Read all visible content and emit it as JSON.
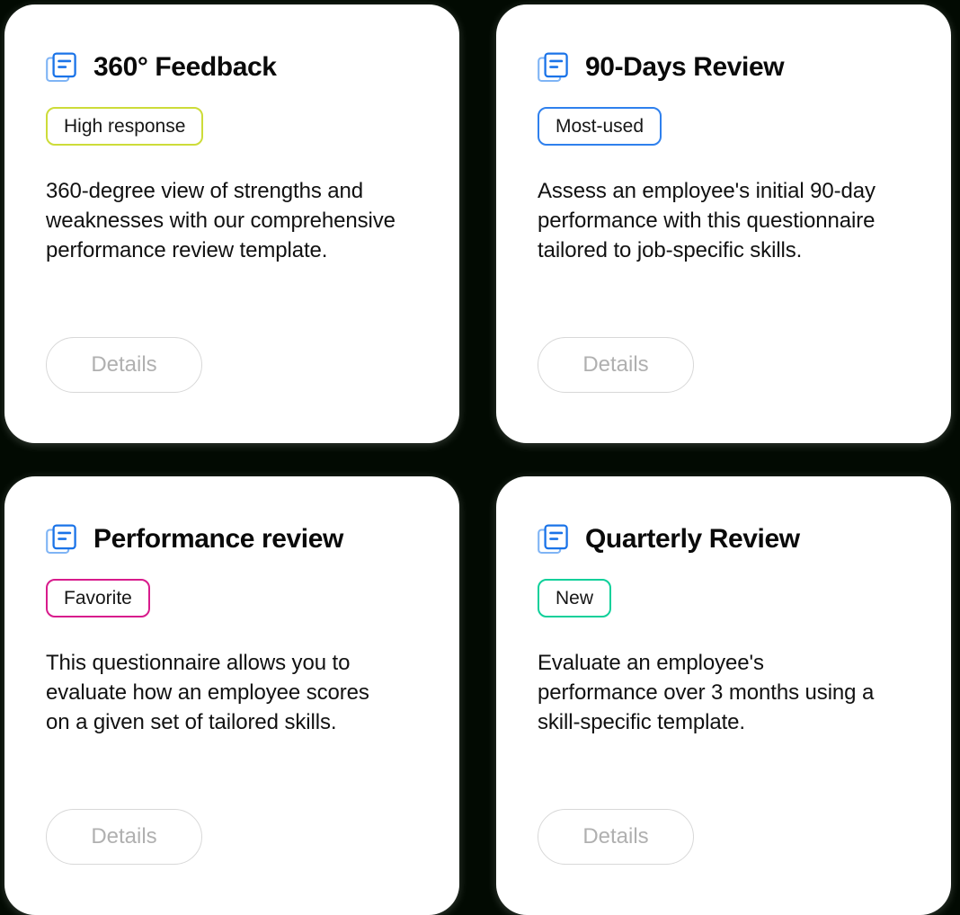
{
  "theme": {
    "page_background": "#020a02",
    "card_background": "#ffffff",
    "icon_color": "#1a73e8",
    "title_color": "#0a0a0a",
    "body_color": "#111111",
    "details_border_color": "#d8d8d8",
    "details_text_color": "#b0b0b0"
  },
  "cards": [
    {
      "icon": "document-list-icon",
      "title": "360° Feedback",
      "badge": {
        "label": "High response",
        "color": "#cddc39"
      },
      "description": "360-degree view of strengths and weaknesses with our comprehensive performance review template.",
      "details_label": "Details"
    },
    {
      "icon": "document-list-icon",
      "title": "90-Days Review",
      "badge": {
        "label": "Most-used",
        "color": "#2f80ed"
      },
      "description": "Assess an employee's initial 90-day performance with this questionnaire tailored to job-specific skills.",
      "details_label": "Details"
    },
    {
      "icon": "document-list-icon",
      "title": "Performance review",
      "badge": {
        "label": "Favorite",
        "color": "#d81b8c"
      },
      "description": "This questionnaire allows you to evaluate how an employee scores on a given set of tailored skills.",
      "details_label": "Details"
    },
    {
      "icon": "document-list-icon",
      "title": "Quarterly Review",
      "badge": {
        "label": "New",
        "color": "#0fd09a"
      },
      "description": "Evaluate an employee's performance over 3 months using a skill-specific template.",
      "details_label": "Details"
    }
  ]
}
